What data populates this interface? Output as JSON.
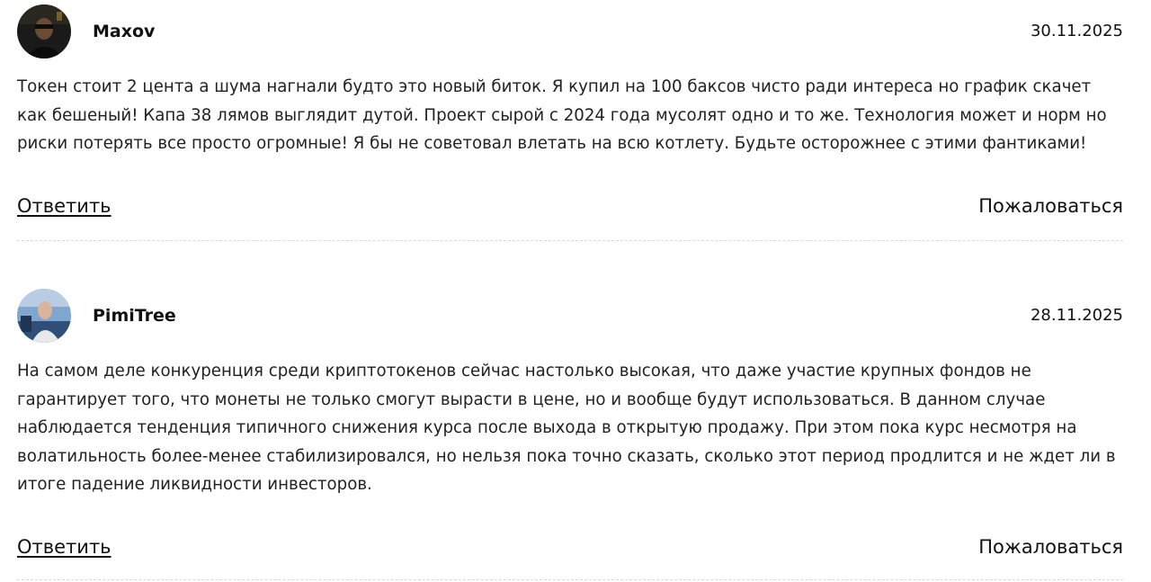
{
  "comments": [
    {
      "author": "Maxov",
      "avatar": "avatar-dark-photo",
      "date": "30.11.2025",
      "text": "Токен стоит 2 цента а шума нагнали будто это новый биток. Я купил на 100 баксов чисто ради интереса но график скачет как бешеный! Капа 38 лямов выглядит дутой. Проект сырой с 2024 года мусолят одно и то же. Технология может и норм но риски потерять все просто огромные! Я бы не советовал влетать на всю котлету. Будьте осторожнее с этими фантиками!",
      "reply_label": "Ответить",
      "report_label": "Пожаловаться"
    },
    {
      "author": "PimiTree",
      "avatar": "avatar-blue-photo",
      "date": "28.11.2025",
      "text": "На самом деле конкуренция среди криптотокенов сейчас настолько высокая, что даже участие крупных фондов не гарантирует того, что монеты не только смогут вырасти в цене, но и вообще будут использоваться. В данном случае наблюдается тенденция типичного снижения курса после выхода в открытую продажу. При этом пока курс несмотря на волатильность более-менее стабилизировался, но нельзя пока точно сказать, сколько этот период продлится и не ждет ли в итоге падение ликвидности инвесторов.",
      "reply_label": "Ответить",
      "report_label": "Пожаловаться"
    }
  ],
  "colors": {
    "text": "#111111",
    "divider": "#d8d8d8",
    "background": "#ffffff"
  }
}
